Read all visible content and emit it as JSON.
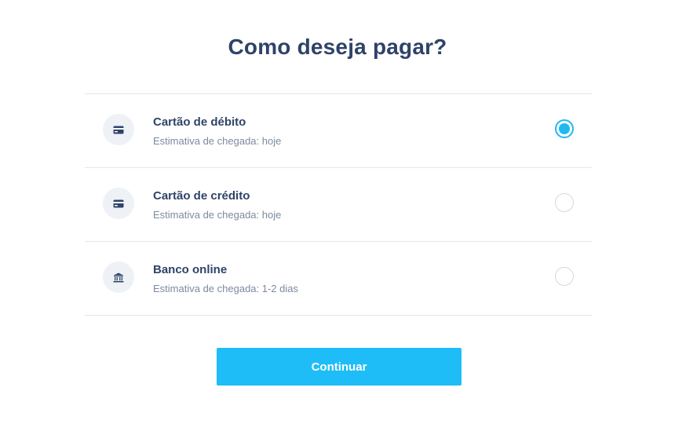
{
  "title": "Como deseja pagar?",
  "options": [
    {
      "label": "Cartão de débito",
      "subtitle": "Estimativa de chegada: hoje",
      "icon": "credit-card-icon",
      "selected": true
    },
    {
      "label": "Cartão de crédito",
      "subtitle": "Estimativa de chegada: hoje",
      "icon": "credit-card-icon",
      "selected": false
    },
    {
      "label": "Banco online",
      "subtitle": "Estimativa de chegada: 1-2 dias",
      "icon": "bank-icon",
      "selected": false
    }
  ],
  "continue_label": "Continuar",
  "colors": {
    "heading": "#2e4369",
    "subtext": "#7d8a9e",
    "accent": "#1ebdf7",
    "divider": "#e3e7ec",
    "icon_bg": "#eef1f5"
  }
}
